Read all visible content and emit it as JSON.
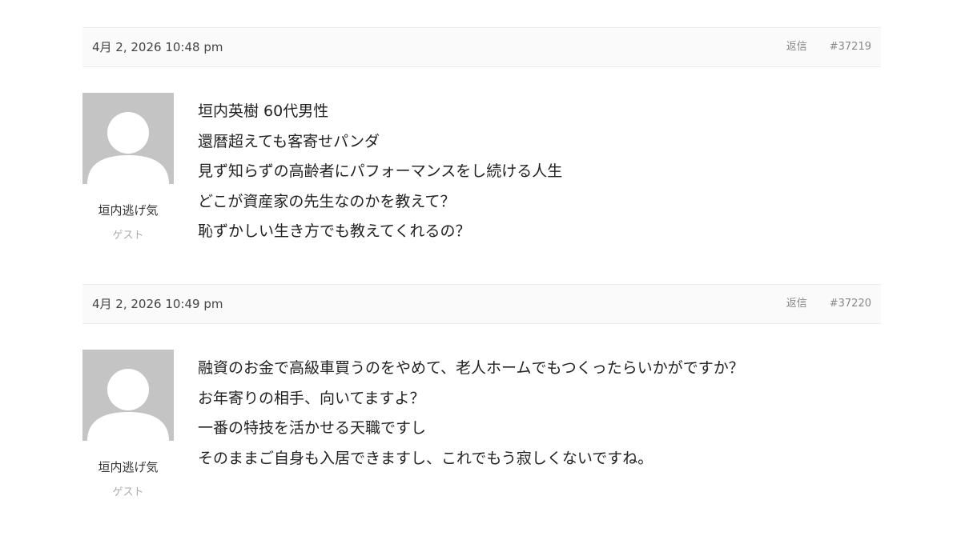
{
  "posts": [
    {
      "date": "4月 2, 2026 10:48 pm",
      "reply_label": "返信",
      "number": "#37219",
      "author": "垣内逃げ気",
      "role": "ゲスト",
      "avatar_icon": "default-user-avatar",
      "lines": [
        "垣内英樹 60代男性",
        "還暦超えても客寄せパンダ",
        "見ず知らずの高齢者にパフォーマンスをし続ける人生",
        "どこが資産家の先生なのかを教えて？",
        "恥ずかしい生き方でも教えてくれるの？"
      ]
    },
    {
      "date": "4月 2, 2026 10:49 pm",
      "reply_label": "返信",
      "number": "#37220",
      "author": "垣内逃げ気",
      "role": "ゲスト",
      "avatar_icon": "default-user-avatar",
      "lines": [
        "融資のお金で高級車買うのをやめて、老人ホームでもつくったらいかがですか？",
        "お年寄りの相手、向いてますよ？",
        "一番の特技を活かせる天職ですし",
        "そのままご自身も入居できますし、これでもう寂しくないですね。"
      ]
    }
  ],
  "colors": {
    "header_bg": "#fafafa",
    "border": "#ececec",
    "avatar_bg": "#c4c4c4",
    "meta_text": "#888888",
    "role_text": "#aaaaaa"
  }
}
